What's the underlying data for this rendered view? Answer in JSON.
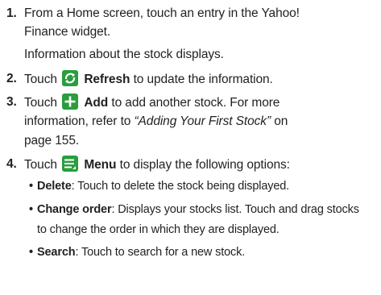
{
  "steps": [
    {
      "number": "1.",
      "line1": "From a Home screen, touch an entry in the Yahoo!",
      "line2": "Finance widget.",
      "note": "Information about the stock displays."
    },
    {
      "number": "2.",
      "pre": "Touch",
      "icon": "refresh-icon",
      "label": "Refresh",
      "post": "to update the information."
    },
    {
      "number": "3.",
      "pre": "Touch",
      "icon": "add-icon",
      "label": "Add",
      "post": "to add another stock. For more",
      "line2": "information, refer to ",
      "ref": "“Adding Your First Stock”",
      "line2_post": " on",
      "line3": "page 155."
    },
    {
      "number": "4.",
      "pre": "Touch",
      "icon": "menu-icon",
      "label": "Menu",
      "post": "to display the following options:",
      "options": [
        {
          "bullet": "•",
          "term": "Delete",
          "desc": ": Touch to delete the stock being displayed."
        },
        {
          "bullet": "•",
          "term": "Change order",
          "desc": ": Displays your stocks list. Touch and drag stocks",
          "desc2": "to change the order in which they are displayed."
        },
        {
          "bullet": "•",
          "term": "Search",
          "desc": ": Touch to search for a new stock."
        }
      ]
    }
  ],
  "colors": {
    "icon_bg": "#2a9d3e",
    "text": "#231f20"
  }
}
